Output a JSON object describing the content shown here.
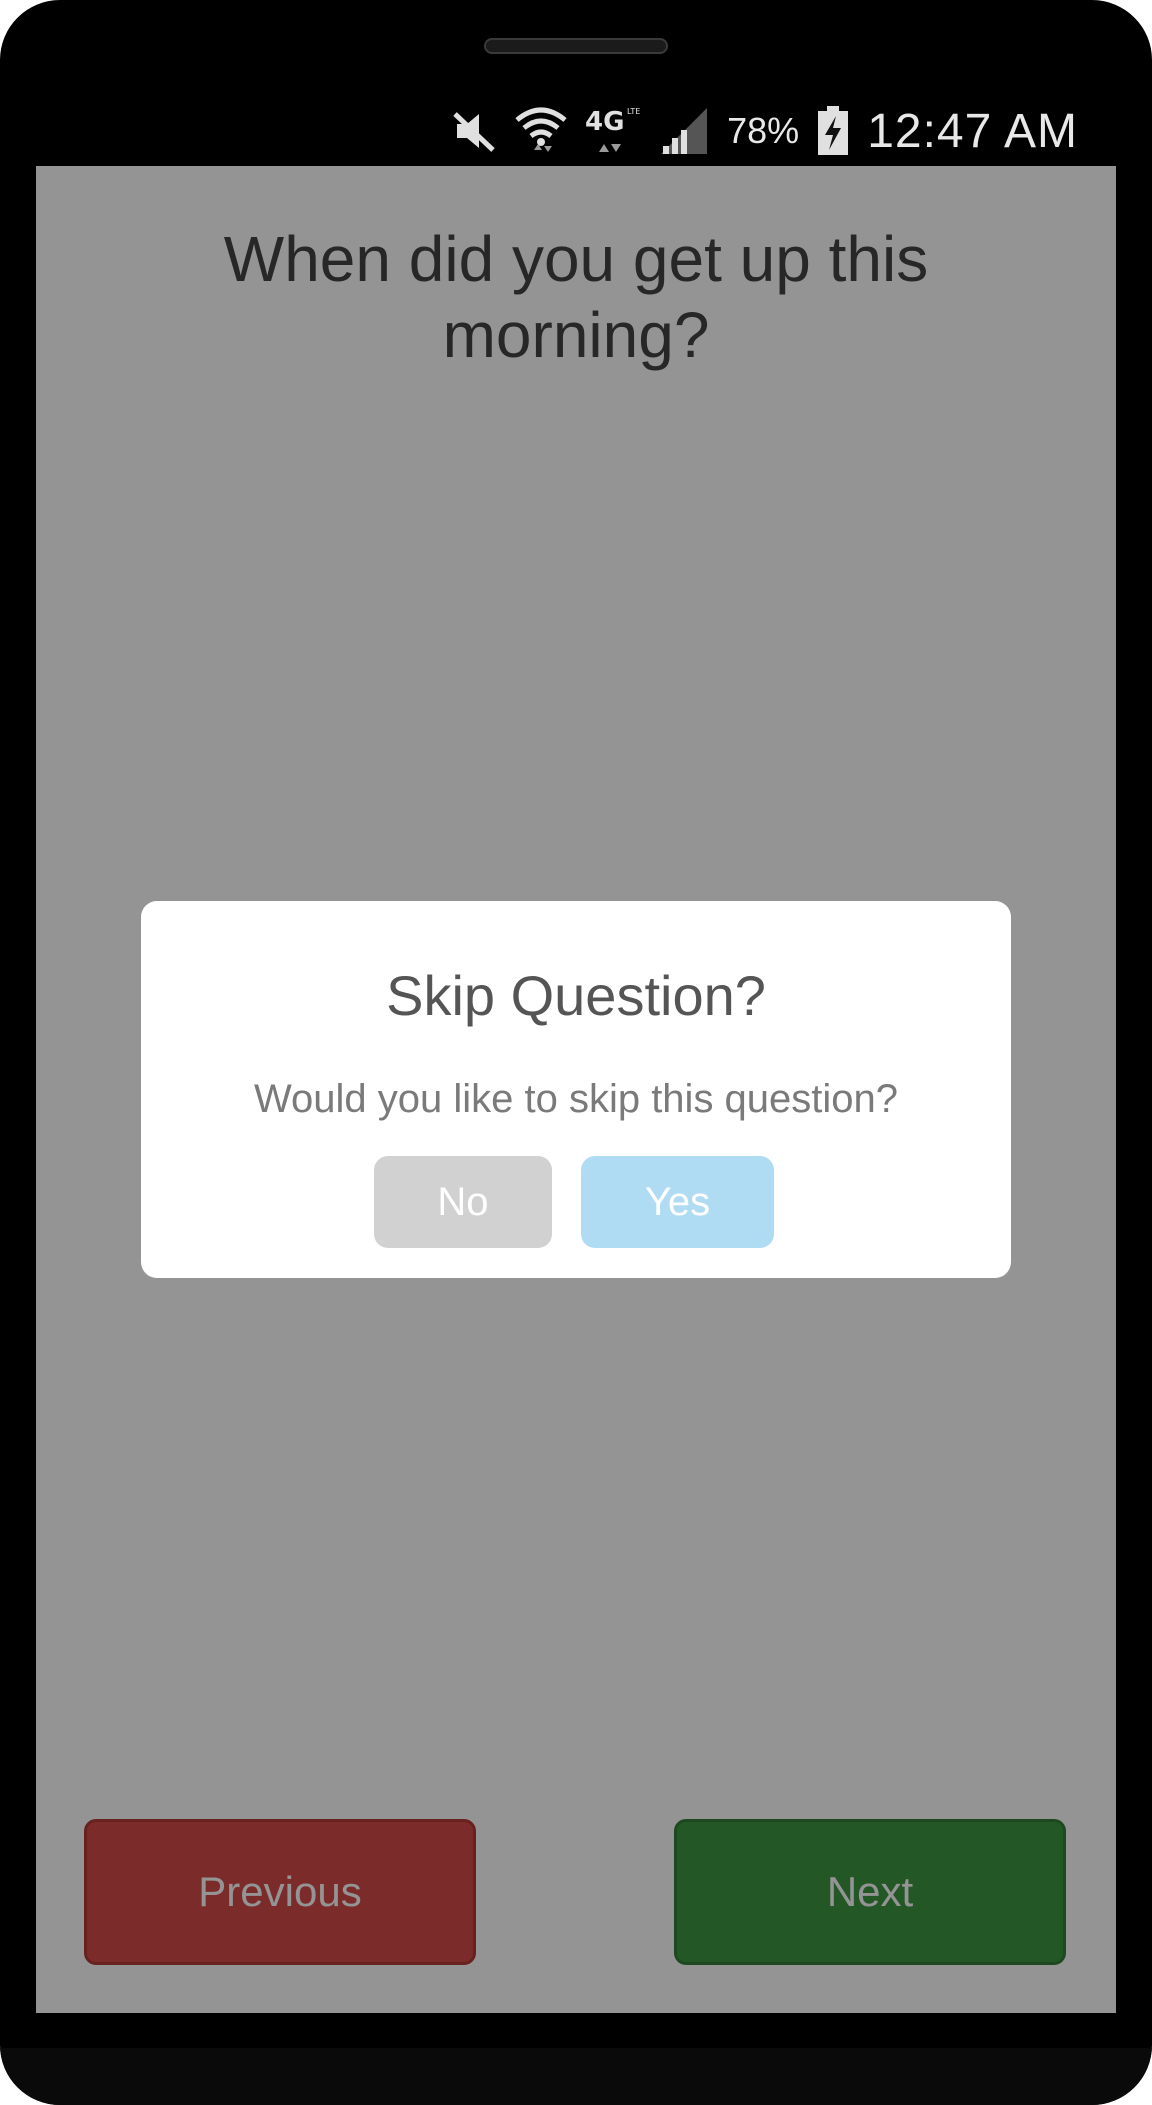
{
  "status_bar": {
    "battery_percent": "78%",
    "time": "12:47 AM",
    "icons": [
      "mute-icon",
      "wifi-icon",
      "4g-lte-icon",
      "signal-icon",
      "battery-charging-icon"
    ]
  },
  "question": {
    "text": "When did you get up this morning?"
  },
  "navigation": {
    "previous_label": "Previous",
    "next_label": "Next"
  },
  "dialog": {
    "title": "Skip Question?",
    "message": "Would you like to skip this question?",
    "no_label": "No",
    "yes_label": "Yes"
  },
  "colors": {
    "previous_button": "#d44a48",
    "next_button": "#3f9743",
    "no_button": "#d1d1d1",
    "yes_button": "#afdcf2"
  }
}
